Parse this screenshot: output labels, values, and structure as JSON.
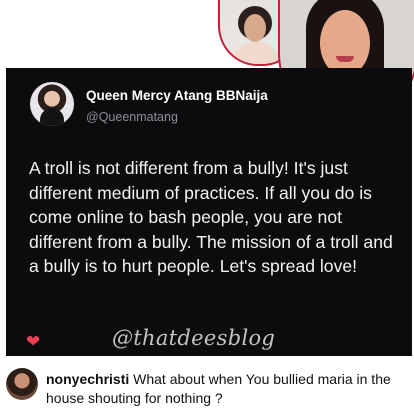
{
  "tweet": {
    "author_name": "Queen Mercy Atang BBNaija",
    "author_handle": "@Queenmatang",
    "text": "A troll is not different from a bully! It's just different medium of practices. If all you do is come online to bash people, you are not different from a bully. The mission of a troll and a bully is to hurt people. Let's spread love!",
    "heart": "❤",
    "watermark": "@thatdeesblog"
  },
  "comment": {
    "username": "nonyechristi",
    "text": "What about when You bullied maria in the house shouting for nothing ?"
  },
  "colors": {
    "card_background": "#0c0c0f",
    "heart": "#ef4056",
    "photo_border": "#c61f3a"
  }
}
